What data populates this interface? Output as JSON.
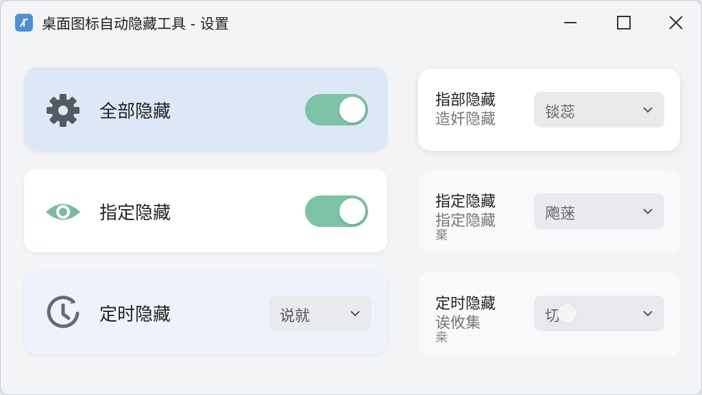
{
  "window": {
    "title": "桌面图标自动隐藏工具 - 设置",
    "app_icon": "app-logo-icon",
    "controls": [
      "minimize-icon",
      "maximize-icon",
      "close-icon"
    ]
  },
  "colors": {
    "accent_toggle": "#7cc3a6",
    "eye_icon": "#7ab9a1",
    "card_blue": "#dde8f7"
  },
  "left_cards": [
    {
      "label": "全部隐藏",
      "icon": "gear-icon",
      "control": "toggle",
      "on": true
    },
    {
      "label": "指定隐藏",
      "icon": "eye-icon",
      "control": "toggle",
      "on": true
    },
    {
      "label": "定时隐藏",
      "icon": "timer-icon",
      "control": "dropdown",
      "value": "说就"
    }
  ],
  "right_cards": [
    {
      "title": "指部隐藏",
      "subtitle": "造奷隐藏",
      "subtitle2": "",
      "value": "锬蕊"
    },
    {
      "title": "指定隐藏",
      "subtitle": "指定隐藏",
      "subtitle2": "棄",
      "value": "飑蒾"
    },
    {
      "title": "定时隐藏",
      "subtitle": "诶攸集",
      "subtitle2": "桒",
      "value": "切"
    }
  ]
}
